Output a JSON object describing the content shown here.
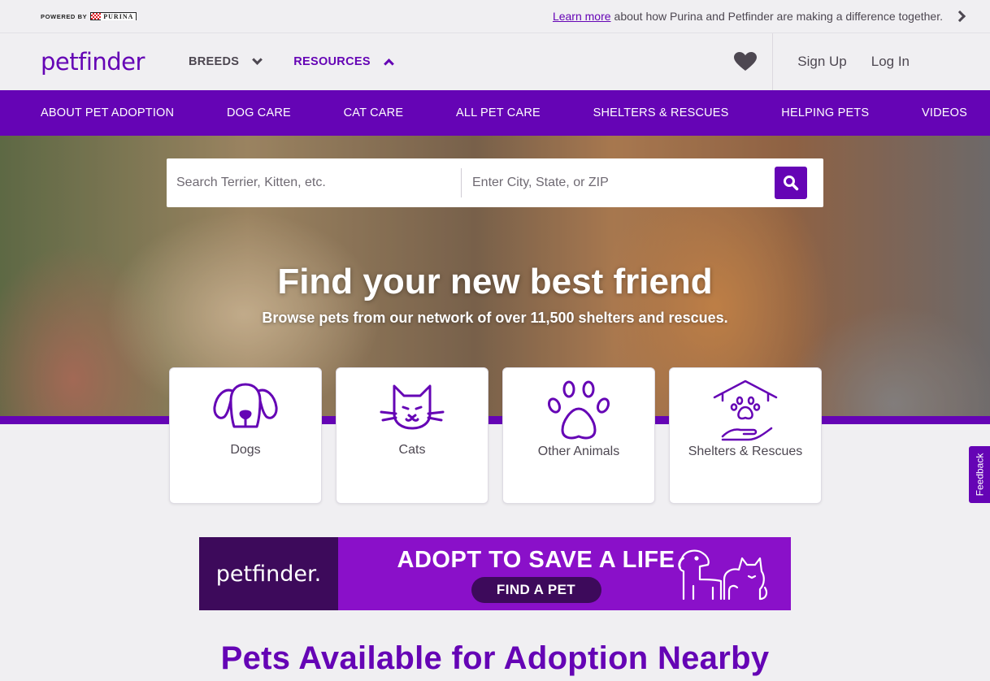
{
  "topbar": {
    "powered_by": "POWERED BY",
    "purina_text": "PURINA",
    "promo_link": "Learn more",
    "promo_text": "about how Purina and Petfinder are making a difference together."
  },
  "header": {
    "logo": "petfinder",
    "nav": [
      {
        "label": "BREEDS"
      },
      {
        "label": "RESOURCES"
      }
    ],
    "sign_up": "Sign Up",
    "log_in": "Log In"
  },
  "subnav": [
    "ABOUT PET ADOPTION",
    "DOG CARE",
    "CAT CARE",
    "ALL PET CARE",
    "SHELTERS & RESCUES",
    "HELPING PETS",
    "VIDEOS"
  ],
  "search": {
    "animal_placeholder": "Search Terrier, Kitten, etc.",
    "location_placeholder": "Enter City, State, or ZIP"
  },
  "hero": {
    "title": "Find your new best friend",
    "subtitle": "Browse pets from our network of over 11,500 shelters and rescues."
  },
  "categories": [
    {
      "label": "Dogs",
      "icon": "dog-icon"
    },
    {
      "label": "Cats",
      "icon": "cat-icon"
    },
    {
      "label": "Other Animals",
      "icon": "paw-icon"
    },
    {
      "label": "Shelters & Rescues",
      "icon": "shelter-icon"
    }
  ],
  "feedback": "Feedback",
  "banner": {
    "logo": "petfinder.",
    "title": "ADOPT TO SAVE A LIFE",
    "button": "FIND A PET"
  },
  "section_title": "Pets Available for Adoption Nearby",
  "colors": {
    "brand": "#6504b5",
    "banner": "#8a10c9",
    "banner_dark": "#3d0a5b"
  }
}
